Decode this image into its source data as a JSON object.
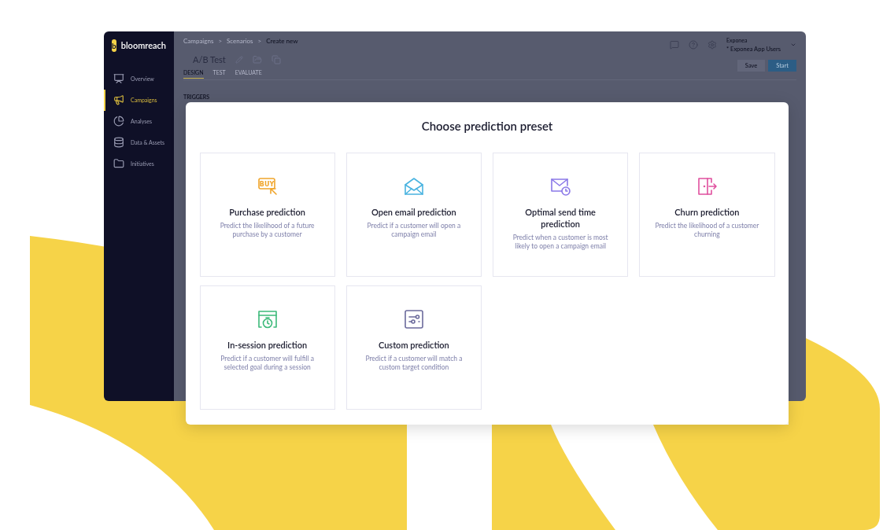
{
  "logo": {
    "mark": "b",
    "name": "bloomreach"
  },
  "sidebar": {
    "items": [
      {
        "label": "Overview",
        "selected": false
      },
      {
        "label": "Campaigns",
        "selected": true
      },
      {
        "label": "Analyses",
        "selected": false
      },
      {
        "label": "Data & Assets",
        "selected": false
      },
      {
        "label": "Initiatives",
        "selected": false
      }
    ]
  },
  "breadcrumb": [
    "Campaigns",
    "Scenarios",
    "Create new"
  ],
  "breadcrumb_separator": ">",
  "title": "A/B Test",
  "project": {
    "label": "Exponea",
    "value": "* Exponea App Users"
  },
  "buttons": {
    "save": "Save",
    "start": "Start"
  },
  "tabs": [
    {
      "label": "DESIGN",
      "selected": true
    },
    {
      "label": "TEST",
      "selected": false
    },
    {
      "label": "EVALUATE",
      "selected": false
    }
  ],
  "section_label": "TRIGGERS",
  "modal": {
    "title": "Choose prediction preset",
    "cards": [
      {
        "kind": "purchase",
        "icon_label": "BUY",
        "title": "Purchase prediction",
        "description": "Predict the likelihood of a future purchase by a customer"
      },
      {
        "kind": "email",
        "title": "Open email prediction",
        "description": "Predict if a customer will open a campaign email"
      },
      {
        "kind": "sendtime",
        "title": "Optimal send time prediction",
        "description": "Predict when a customer is most likely to open a campaign email"
      },
      {
        "kind": "churn",
        "title": "Churn prediction",
        "description": "Predict the likelihood of a customer churning"
      },
      {
        "kind": "session",
        "title": "In-session prediction",
        "description": "Predict if a customer will fulfill a selected goal during a session"
      },
      {
        "kind": "custom",
        "title": "Custom prediction",
        "description": "Predict if a customer will match a custom target condition"
      }
    ]
  }
}
